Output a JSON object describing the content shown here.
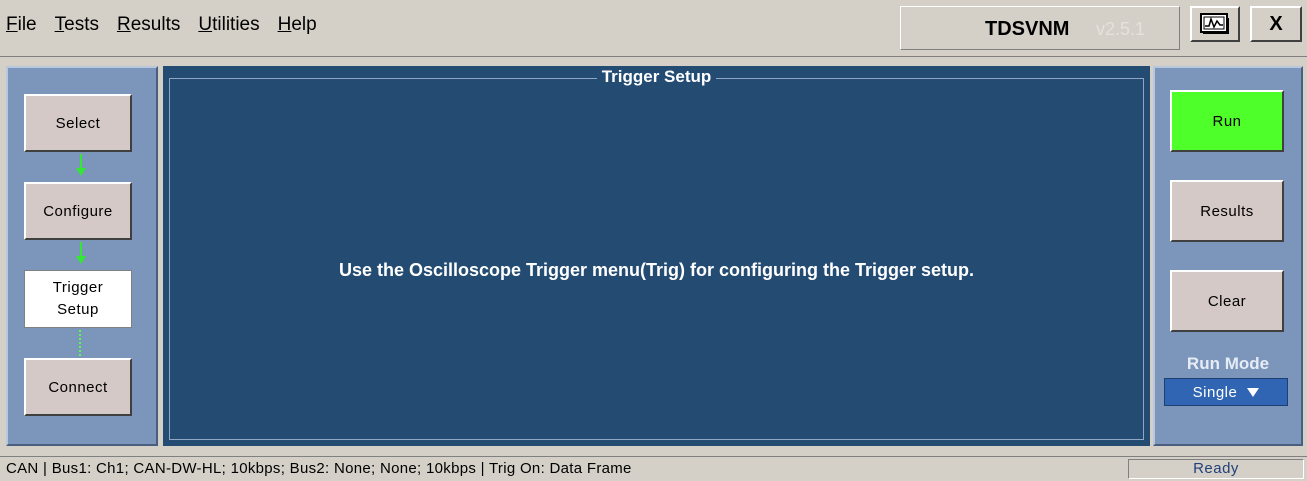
{
  "menu": {
    "items": [
      {
        "label": "File",
        "accel": "F",
        "rest": "ile"
      },
      {
        "label": "Tests",
        "accel": "T",
        "rest": "ests"
      },
      {
        "label": "Results",
        "accel": "R",
        "rest": "esults"
      },
      {
        "label": "Utilities",
        "accel": "U",
        "rest": "tilities"
      },
      {
        "label": "Help",
        "accel": "H",
        "rest": "elp"
      }
    ]
  },
  "app": {
    "name": "TDSVNM",
    "version": "v2.5.1"
  },
  "window": {
    "close_label": "X",
    "scope_icon": "oscilloscope-icon"
  },
  "steps": {
    "select": "Select",
    "configure": "Configure",
    "trigger_line1": "Trigger",
    "trigger_line2": "Setup",
    "connect": "Connect"
  },
  "center": {
    "title": "Trigger Setup",
    "message": "Use the Oscilloscope Trigger menu(Trig) for configuring the Trigger setup."
  },
  "actions": {
    "run": "Run",
    "results": "Results",
    "clear": "Clear",
    "run_mode_label": "Run Mode",
    "run_mode_value": "Single"
  },
  "status": {
    "text": "CAN  |  Bus1: Ch1; CAN-DW-HL; 10kbps; Bus2: None; None; 10kbps  |  Trig On: Data Frame",
    "state": "Ready"
  },
  "colors": {
    "panel_bg": "#244c72",
    "side_bg": "#7b95bb",
    "run_green": "#4fff2a",
    "flow_arrow": "#33e833"
  }
}
